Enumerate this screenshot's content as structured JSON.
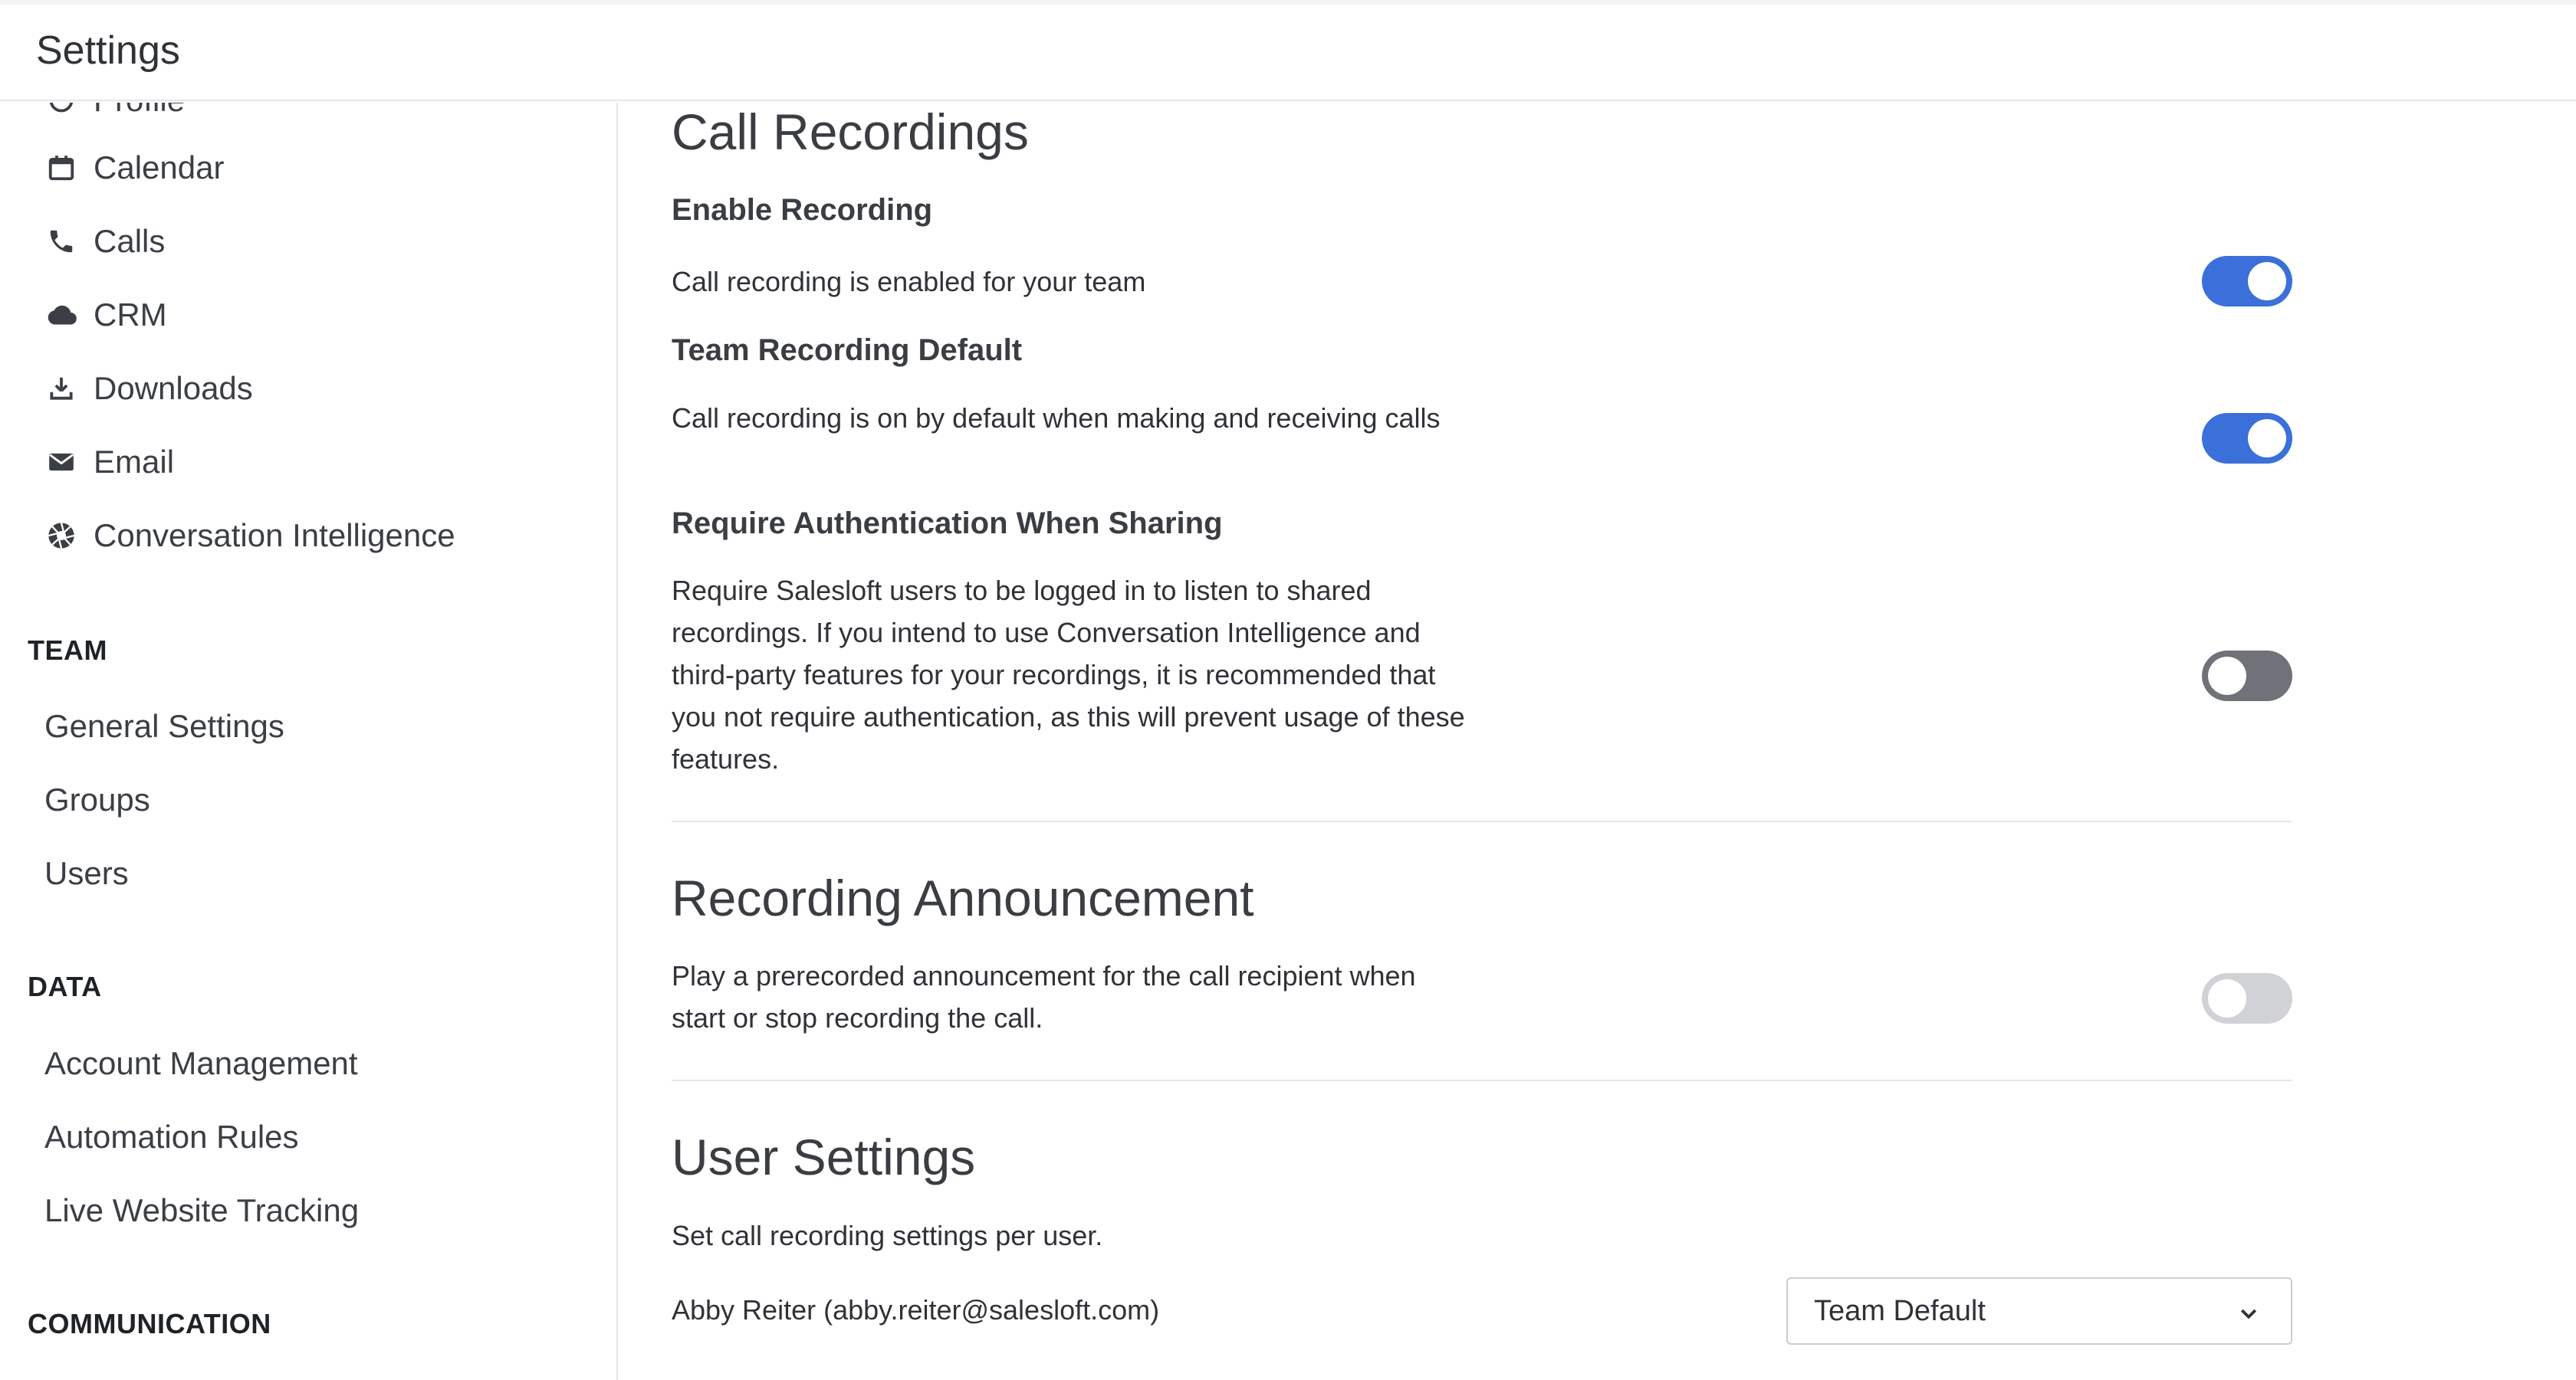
{
  "header": {
    "title": "Settings"
  },
  "sidebar": {
    "partial_item": {
      "label": "Profile"
    },
    "personal_items": [
      {
        "label": "Calendar",
        "icon": "calendar-icon"
      },
      {
        "label": "Calls",
        "icon": "phone-icon"
      },
      {
        "label": "CRM",
        "icon": "cloud-icon"
      },
      {
        "label": "Downloads",
        "icon": "download-icon"
      },
      {
        "label": "Email",
        "icon": "envelope-icon"
      },
      {
        "label": "Conversation Intelligence",
        "icon": "aperture-icon"
      }
    ],
    "team_heading": "TEAM",
    "team_items": [
      {
        "label": "General Settings"
      },
      {
        "label": "Groups"
      },
      {
        "label": "Users"
      }
    ],
    "data_heading": "DATA",
    "data_items": [
      {
        "label": "Account Management"
      },
      {
        "label": "Automation Rules"
      },
      {
        "label": "Live Website Tracking"
      }
    ],
    "communication_heading": "COMMUNICATION"
  },
  "main": {
    "call_recordings": {
      "title": "Call Recordings",
      "enable": {
        "title": "Enable Recording",
        "desc": "Call recording is enabled for your team",
        "enabled": true
      },
      "team_default": {
        "title": "Team Recording Default",
        "desc": "Call recording is on by default when making and receiving calls",
        "enabled": true
      },
      "require_auth": {
        "title": "Require Authentication When Sharing",
        "desc": "Require Salesloft users to be logged in to listen to shared recordings. If you intend to use Conversation Intelligence and third-party features for your recordings, it is recommended that you not require authentication, as this will prevent usage of these features.",
        "enabled": false
      }
    },
    "announcement": {
      "title": "Recording Announcement",
      "desc": "Play a prerecorded announcement for the call recipient when start or stop recording the call.",
      "enabled": false
    },
    "user_settings": {
      "title": "User Settings",
      "desc": "Set call recording settings per user.",
      "users": [
        {
          "name": "Abby Reiter (abby.reiter@salesloft.com)",
          "value": "Team Default"
        }
      ]
    }
  },
  "colors": {
    "accent": "#3b6fd9",
    "toggle_off_dark": "#6f7278",
    "toggle_off_light": "#d0d2d6"
  }
}
